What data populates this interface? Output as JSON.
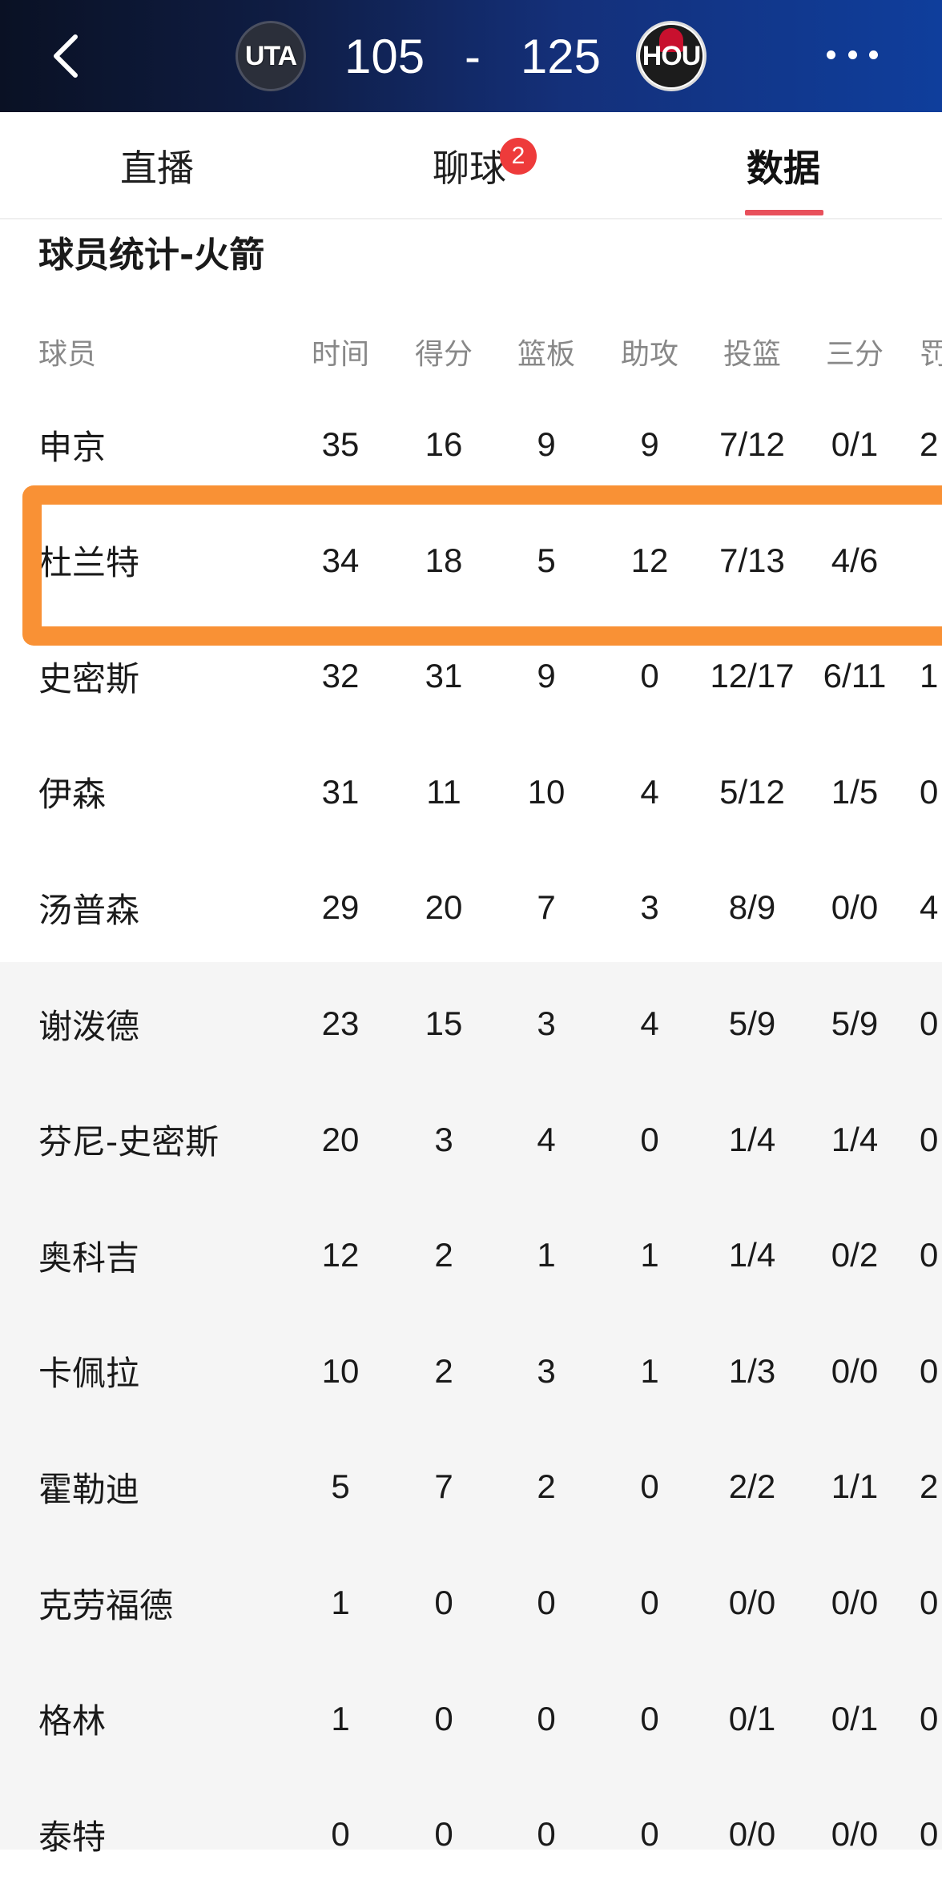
{
  "header": {
    "home_team_abbr": "UTA",
    "away_team_abbr": "HOU",
    "home_score": "105",
    "separator": "-",
    "away_score": "125",
    "back_icon": "chevron-left-icon",
    "more_icon": "more-dots-icon",
    "colors": {
      "bar_start": "#0a1124",
      "bar_end": "#0f3e9c",
      "hou_red": "#c8102e"
    }
  },
  "tabs": {
    "items": [
      {
        "label": "直播"
      },
      {
        "label": "聊球"
      },
      {
        "label": "数据"
      }
    ],
    "chat_badge": "2",
    "active_index": 2,
    "accent": "#e8505b"
  },
  "section": {
    "title": "球员统计-火箭"
  },
  "table": {
    "headers": [
      "球员",
      "时间",
      "得分",
      "篮板",
      "助攻",
      "投篮",
      "三分",
      "罚"
    ],
    "rows": [
      {
        "name": "申京",
        "min": "35",
        "pts": "16",
        "reb": "9",
        "ast": "9",
        "fg": "7/12",
        "three": "0/1",
        "ft": "2"
      },
      {
        "name": "杜兰特",
        "min": "34",
        "pts": "18",
        "reb": "5",
        "ast": "12",
        "fg": "7/13",
        "three": "4/6",
        "ft": ""
      },
      {
        "name": "史密斯",
        "min": "32",
        "pts": "31",
        "reb": "9",
        "ast": "0",
        "fg": "12/17",
        "three": "6/11",
        "ft": "1"
      },
      {
        "name": "伊森",
        "min": "31",
        "pts": "11",
        "reb": "10",
        "ast": "4",
        "fg": "5/12",
        "three": "1/5",
        "ft": "0"
      },
      {
        "name": "汤普森",
        "min": "29",
        "pts": "20",
        "reb": "7",
        "ast": "3",
        "fg": "8/9",
        "three": "0/0",
        "ft": "4"
      },
      {
        "name": "谢泼德",
        "min": "23",
        "pts": "15",
        "reb": "3",
        "ast": "4",
        "fg": "5/9",
        "three": "5/9",
        "ft": "0"
      },
      {
        "name": "芬尼-史密斯",
        "min": "20",
        "pts": "3",
        "reb": "4",
        "ast": "0",
        "fg": "1/4",
        "three": "1/4",
        "ft": "0"
      },
      {
        "name": "奥科吉",
        "min": "12",
        "pts": "2",
        "reb": "1",
        "ast": "1",
        "fg": "1/4",
        "three": "0/2",
        "ft": "0"
      },
      {
        "name": "卡佩拉",
        "min": "10",
        "pts": "2",
        "reb": "3",
        "ast": "1",
        "fg": "1/3",
        "three": "0/0",
        "ft": "0"
      },
      {
        "name": "霍勒迪",
        "min": "5",
        "pts": "7",
        "reb": "2",
        "ast": "0",
        "fg": "2/2",
        "three": "1/1",
        "ft": "2"
      },
      {
        "name": "克劳福德",
        "min": "1",
        "pts": "0",
        "reb": "0",
        "ast": "0",
        "fg": "0/0",
        "three": "0/0",
        "ft": "0"
      },
      {
        "name": "格林",
        "min": "1",
        "pts": "0",
        "reb": "0",
        "ast": "0",
        "fg": "0/1",
        "three": "0/1",
        "ft": "0"
      },
      {
        "name": "泰特",
        "min": "0",
        "pts": "0",
        "reb": "0",
        "ast": "0",
        "fg": "0/0",
        "three": "0/0",
        "ft": "0"
      }
    ],
    "highlight_color": "#f99135",
    "bench_bg": "#f5f5f5"
  }
}
